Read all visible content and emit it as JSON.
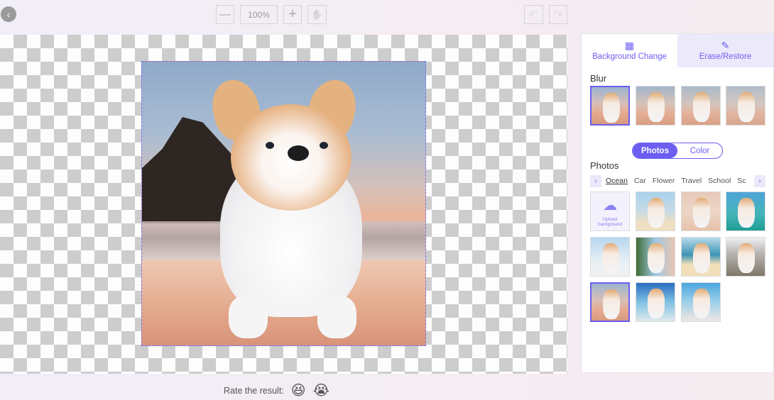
{
  "toolbar": {
    "back_icon": "‹",
    "zoom_out_icon": "—",
    "zoom_level": "100%",
    "zoom_in_icon": "+",
    "pan_icon": "✋",
    "undo_icon": "↶",
    "redo_icon": "↷"
  },
  "panel": {
    "tabs": [
      {
        "label": "Background Change",
        "icon": "▦",
        "active": true
      },
      {
        "label": "Erase/Restore",
        "icon": "✎",
        "active": false
      }
    ],
    "blur": {
      "title": "Blur",
      "options": [
        "blur-0",
        "blur-1",
        "blur-2",
        "blur-3"
      ],
      "selected_index": 0
    },
    "mode_toggle": {
      "photos": "Photos",
      "color": "Color",
      "active": "Photos"
    },
    "photos": {
      "title": "Photos",
      "prev_icon": "‹",
      "next_icon": "›",
      "categories": [
        "Ocean",
        "Car",
        "Flower",
        "Travel",
        "School",
        "Sc"
      ],
      "active_category": "Ocean",
      "upload_label": "Upload background",
      "upload_icon": "☁",
      "selected_index": 7
    }
  },
  "rating": {
    "label": "Rate the result:",
    "good_icon": "😆",
    "bad_icon": "😭"
  },
  "colors": {
    "accent": "#6b5ef0"
  }
}
